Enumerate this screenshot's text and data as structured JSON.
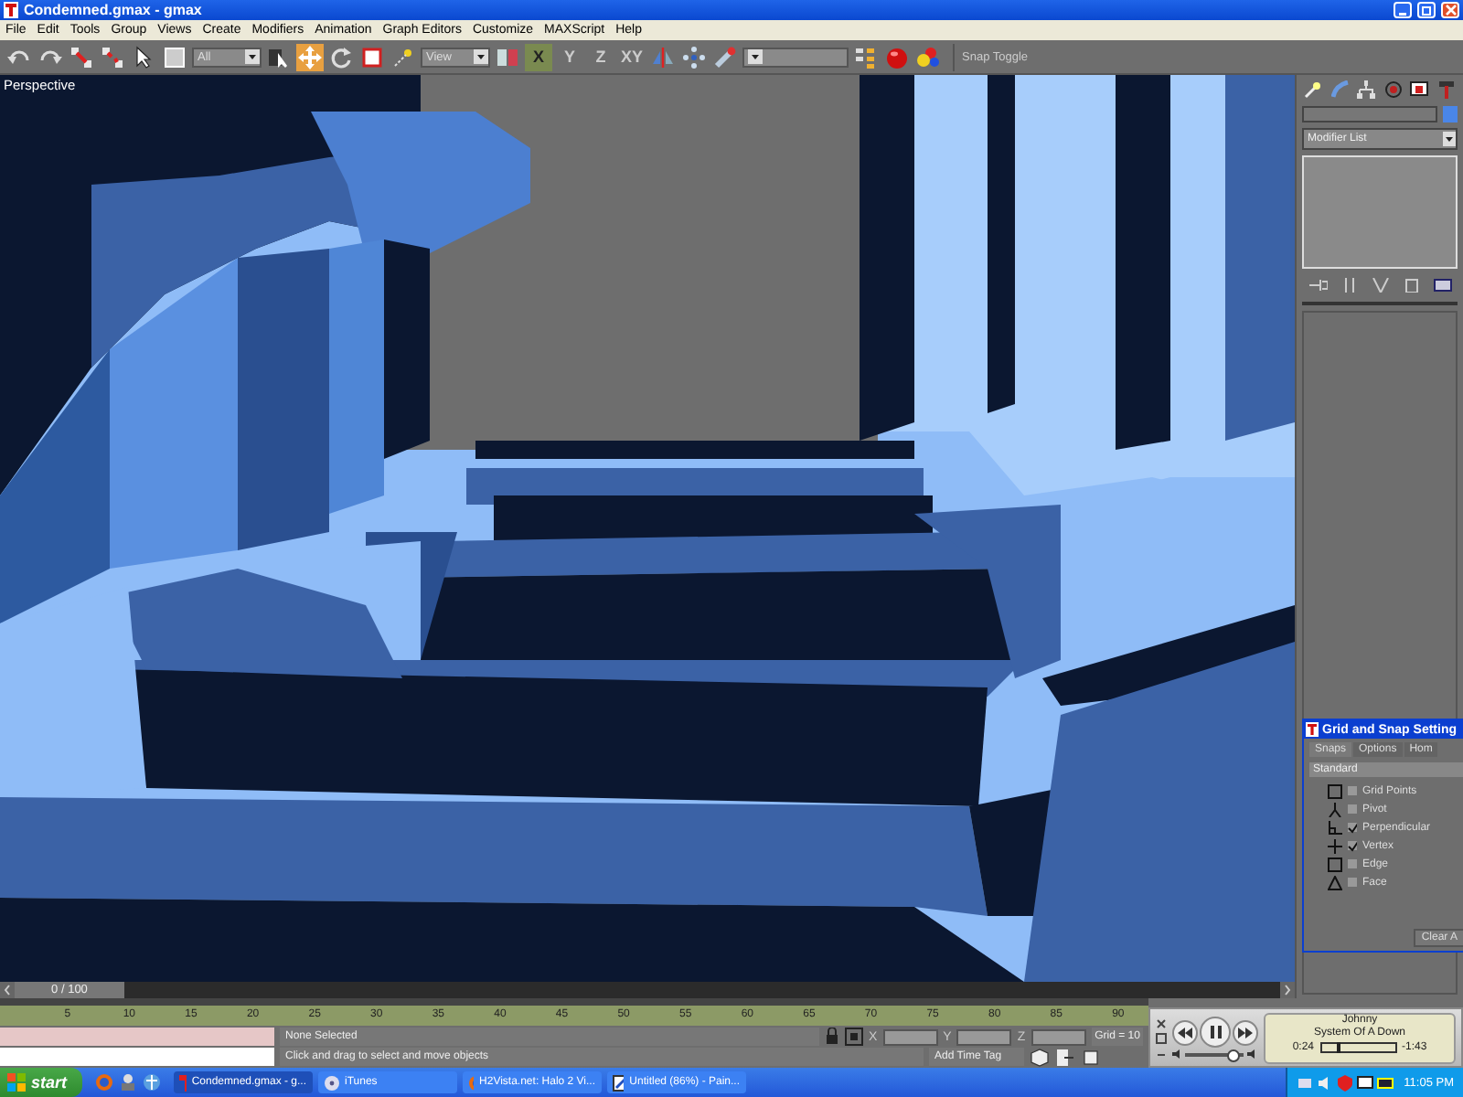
{
  "window": {
    "title": "Condemned.gmax - gmax"
  },
  "menu": [
    "File",
    "Edit",
    "Tools",
    "Group",
    "Views",
    "Create",
    "Modifiers",
    "Animation",
    "Graph Editors",
    "Customize",
    "MAXScript",
    "Help"
  ],
  "toolbar": [
    {
      "kind": "undo",
      "selected": false
    },
    {
      "kind": "redo",
      "selected": false
    },
    {
      "kind": "link",
      "selected": false
    },
    {
      "kind": "unlink",
      "selected": false
    },
    {
      "kind": "pointer",
      "selected": false
    },
    {
      "kind": "region",
      "selected": false
    },
    {
      "kind": "dropdown",
      "value": "All",
      "selected": false
    },
    {
      "kind": "select-name",
      "selected": false
    },
    {
      "kind": "move",
      "selected": true
    },
    {
      "kind": "rotate",
      "selected": false
    },
    {
      "kind": "scale",
      "selected": false
    },
    {
      "kind": "pivot",
      "selected": false
    },
    {
      "kind": "dropdown",
      "value": "View",
      "selected": false
    },
    {
      "kind": "manipulate",
      "selected": false
    },
    {
      "kind": "axis",
      "label": "X",
      "selected": true
    },
    {
      "kind": "axis",
      "label": "Y",
      "selected": false
    },
    {
      "kind": "axis",
      "label": "Z",
      "selected": false
    },
    {
      "kind": "axis",
      "label": "XY",
      "selected": false
    },
    {
      "kind": "mirror",
      "selected": false
    },
    {
      "kind": "array",
      "selected": false
    },
    {
      "kind": "align",
      "selected": false
    },
    {
      "kind": "dropdown",
      "selected": false
    },
    {
      "kind": "named",
      "selected": false
    },
    {
      "kind": "render",
      "selected": false
    },
    {
      "kind": "material",
      "selected": false
    },
    {
      "kind": "text",
      "label": "Snap Toggle",
      "selected": false
    }
  ],
  "viewport": {
    "label": "Perspective"
  },
  "time_slider": {
    "position": "0 / 100",
    "level": 0
  },
  "command_panel": {
    "tabs": [
      {
        "kind": "create",
        "selected": false
      },
      {
        "kind": "modify",
        "selected": false
      },
      {
        "kind": "hierarchy",
        "selected": false
      },
      {
        "kind": "motion",
        "selected": false
      },
      {
        "kind": "display",
        "selected": false
      },
      {
        "kind": "utilities",
        "selected": false
      }
    ],
    "modifier_list": "Modifier List"
  },
  "ruler": [
    "5",
    "10",
    "15",
    "20",
    "25",
    "30",
    "35",
    "40",
    "45",
    "50",
    "55",
    "60",
    "65",
    "70",
    "75",
    "80",
    "85",
    "90"
  ],
  "status": {
    "selection": "None Selected",
    "prompt": "Click and drag to select and move objects",
    "x_label": "X",
    "y_label": "Y",
    "z_label": "Z",
    "grid": "Grid = 10",
    "time_tag": "Add Time Tag"
  },
  "snap_dialog": {
    "title": "Grid and Snap Setting",
    "tabs": [
      {
        "label": "Snaps",
        "selected": true
      },
      {
        "label": "Options",
        "selected": false
      },
      {
        "label": "Hom",
        "selected": false
      }
    ],
    "preset": "Standard",
    "items": [
      {
        "kind": "grid",
        "label": "Grid Points",
        "checked": false
      },
      {
        "kind": "pivot",
        "label": "Pivot",
        "checked": false
      },
      {
        "kind": "perpendicular",
        "label": "Perpendicular",
        "checked": true
      },
      {
        "kind": "vertex",
        "label": "Vertex",
        "checked": true
      },
      {
        "kind": "edge",
        "label": "Edge",
        "checked": false
      },
      {
        "kind": "face",
        "label": "Face",
        "checked": false
      }
    ],
    "button": "Clear A"
  },
  "player": {
    "song": "Johnny",
    "artist": "System Of A Down",
    "elapsed": "0:24",
    "remaining": "-1:43",
    "level": 0.2,
    "volume": {
      "level": 0.8
    }
  },
  "taskbar": {
    "start": "start",
    "tasks": [
      {
        "label": "Condemned.gmax - g...",
        "kind": "gmax",
        "selected": true
      },
      {
        "label": "iTunes",
        "kind": "itunes",
        "selected": false
      },
      {
        "label": "H2Vista.net: Halo 2 Vi...",
        "kind": "browser",
        "selected": false
      },
      {
        "label": "Untitled (86%) - Pain...",
        "kind": "paint",
        "selected": false
      }
    ],
    "clock": "11:05 PM"
  }
}
